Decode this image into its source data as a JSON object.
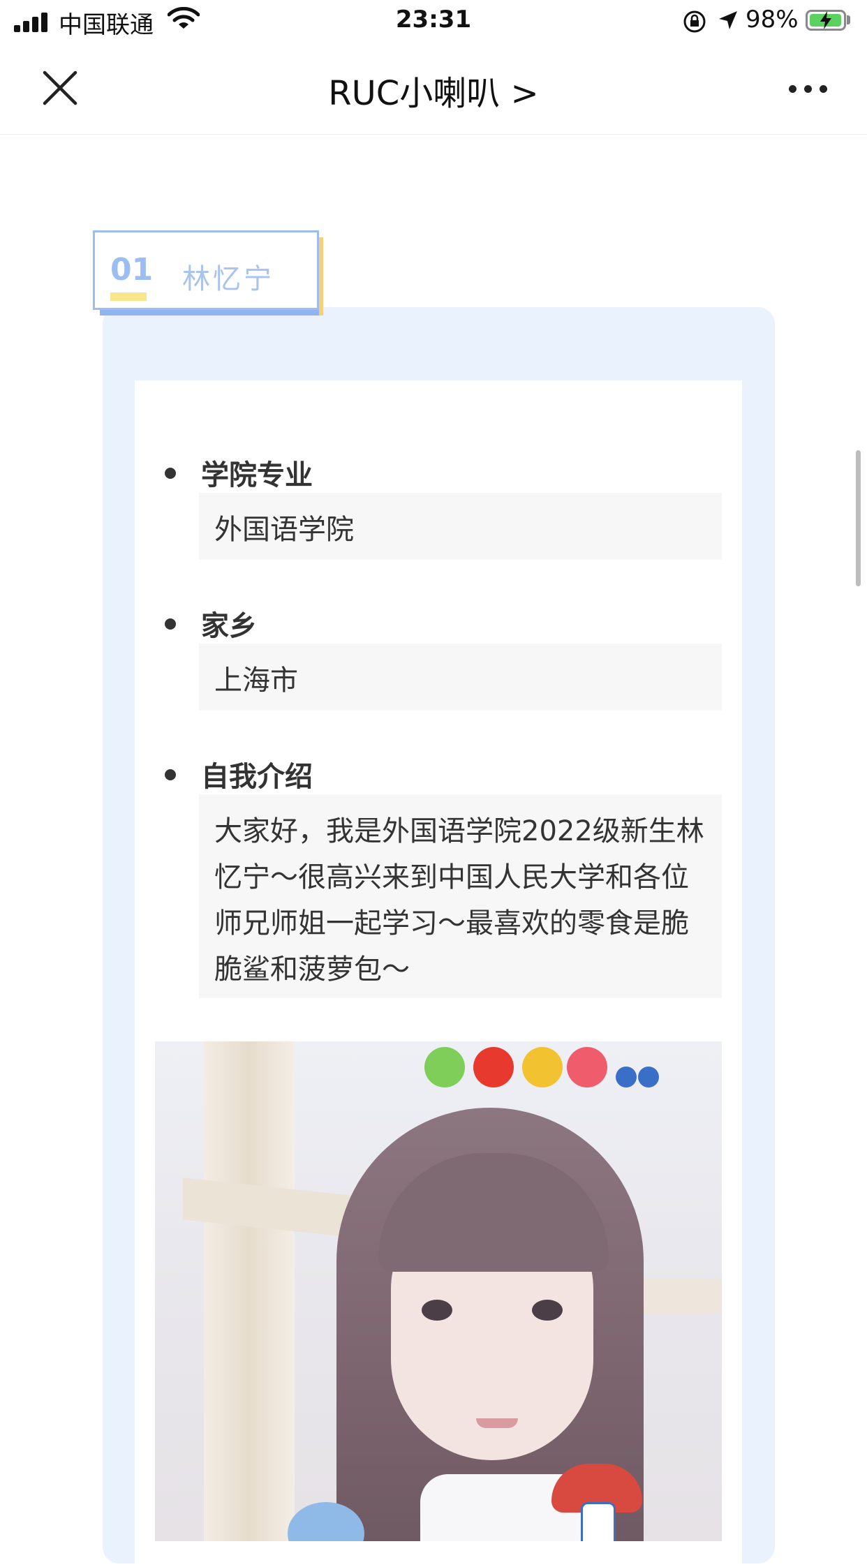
{
  "status_bar": {
    "carrier": "中国联通",
    "time": "23:31",
    "battery_percent": "98%",
    "battery_level": 0.98,
    "icons": [
      "signal-icon",
      "wifi-icon",
      "orientation-lock-icon",
      "location-icon",
      "battery-icon"
    ]
  },
  "nav": {
    "title": "RUC小喇叭 >",
    "icons": [
      "close-icon",
      "more-icon"
    ]
  },
  "profile": {
    "number": "01",
    "name": "林忆宁",
    "sections": [
      {
        "label": "学院专业",
        "value": "外国语学院"
      },
      {
        "label": "家乡",
        "value": "上海市"
      },
      {
        "label": "自我介绍",
        "value": "大家好，我是外国语学院2022级新生林忆宁～很高兴来到中国人民大学和各位师兄师姐一起学习～最喜欢的零食是脆脆鲨和菠萝包～"
      }
    ]
  },
  "colors": {
    "card_bg": "#eaf2fd",
    "accent_blue": "#9cbdf1",
    "accent_yellow": "#f9e58c"
  }
}
